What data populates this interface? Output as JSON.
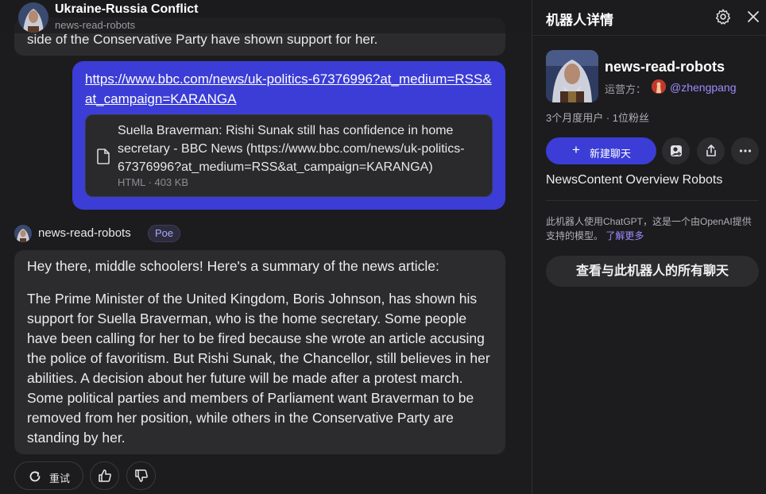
{
  "chat": {
    "header": {
      "title": "Ukraine-Russia Conflict",
      "subtitle": "news-read-robots"
    },
    "previous_message_tail": "side of the Conservative Party have shown support for her.",
    "user_message": {
      "link": "https://www.bbc.com/news/uk-politics-67376996?at_medium=RSS&at_campaign=KARANGA",
      "attachment": {
        "title": "Suella Braverman: Rishi Sunak still has confidence in home secretary - BBC News (https://www.bbc.com/news/uk-politics-67376996?at_medium=RSS&at_campaign=KARANGA)",
        "meta": "HTML · 403 KB",
        "icon": "document-icon"
      }
    },
    "bot_message": {
      "bot_name": "news-read-robots",
      "badge": "Poe",
      "paragraphs": [
        "Hey there, middle schoolers! Here's a summary of the news article:",
        "The Prime Minister of the United Kingdom, Boris Johnson, has shown his support for Suella Braverman, who is the home secretary. Some people have been calling for her to be fired because she wrote an article accusing the police of favoritism. But Rishi Sunak, the Chancellor, still believes in her abilities. A decision about her future will be made after a protest march. Some political parties and members of Parliament want Braverman to be removed from her position, while others in the Conservative Party are standing by her."
      ]
    },
    "actions": {
      "retry_label": "重试",
      "retry_icon": "refresh-icon",
      "like_icon": "thumbs-up-icon",
      "dislike_icon": "thumbs-down-icon"
    }
  },
  "panel": {
    "title": "机器人详情",
    "settings_icon": "gear-icon",
    "close_icon": "close-icon",
    "bot_name": "news-read-robots",
    "operator_label": "运营方：",
    "operator_handle": "@zhengpang",
    "stats": "3个月度用户  ·  1位粉丝",
    "new_chat_label": "新建聊天",
    "description": "NewsContent Overview Robots",
    "note": "此机器人使用ChatGPT，这是一个由OpenAI提供支持的模型。",
    "learn_more": "了解更多",
    "view_all_chats": "查看与此机器人的所有聊天"
  },
  "colors": {
    "background": "#1c1c1e",
    "user_bubble": "#3b3dd6",
    "bot_bubble": "#2c2c2e",
    "accent_link": "#9d8cff"
  }
}
